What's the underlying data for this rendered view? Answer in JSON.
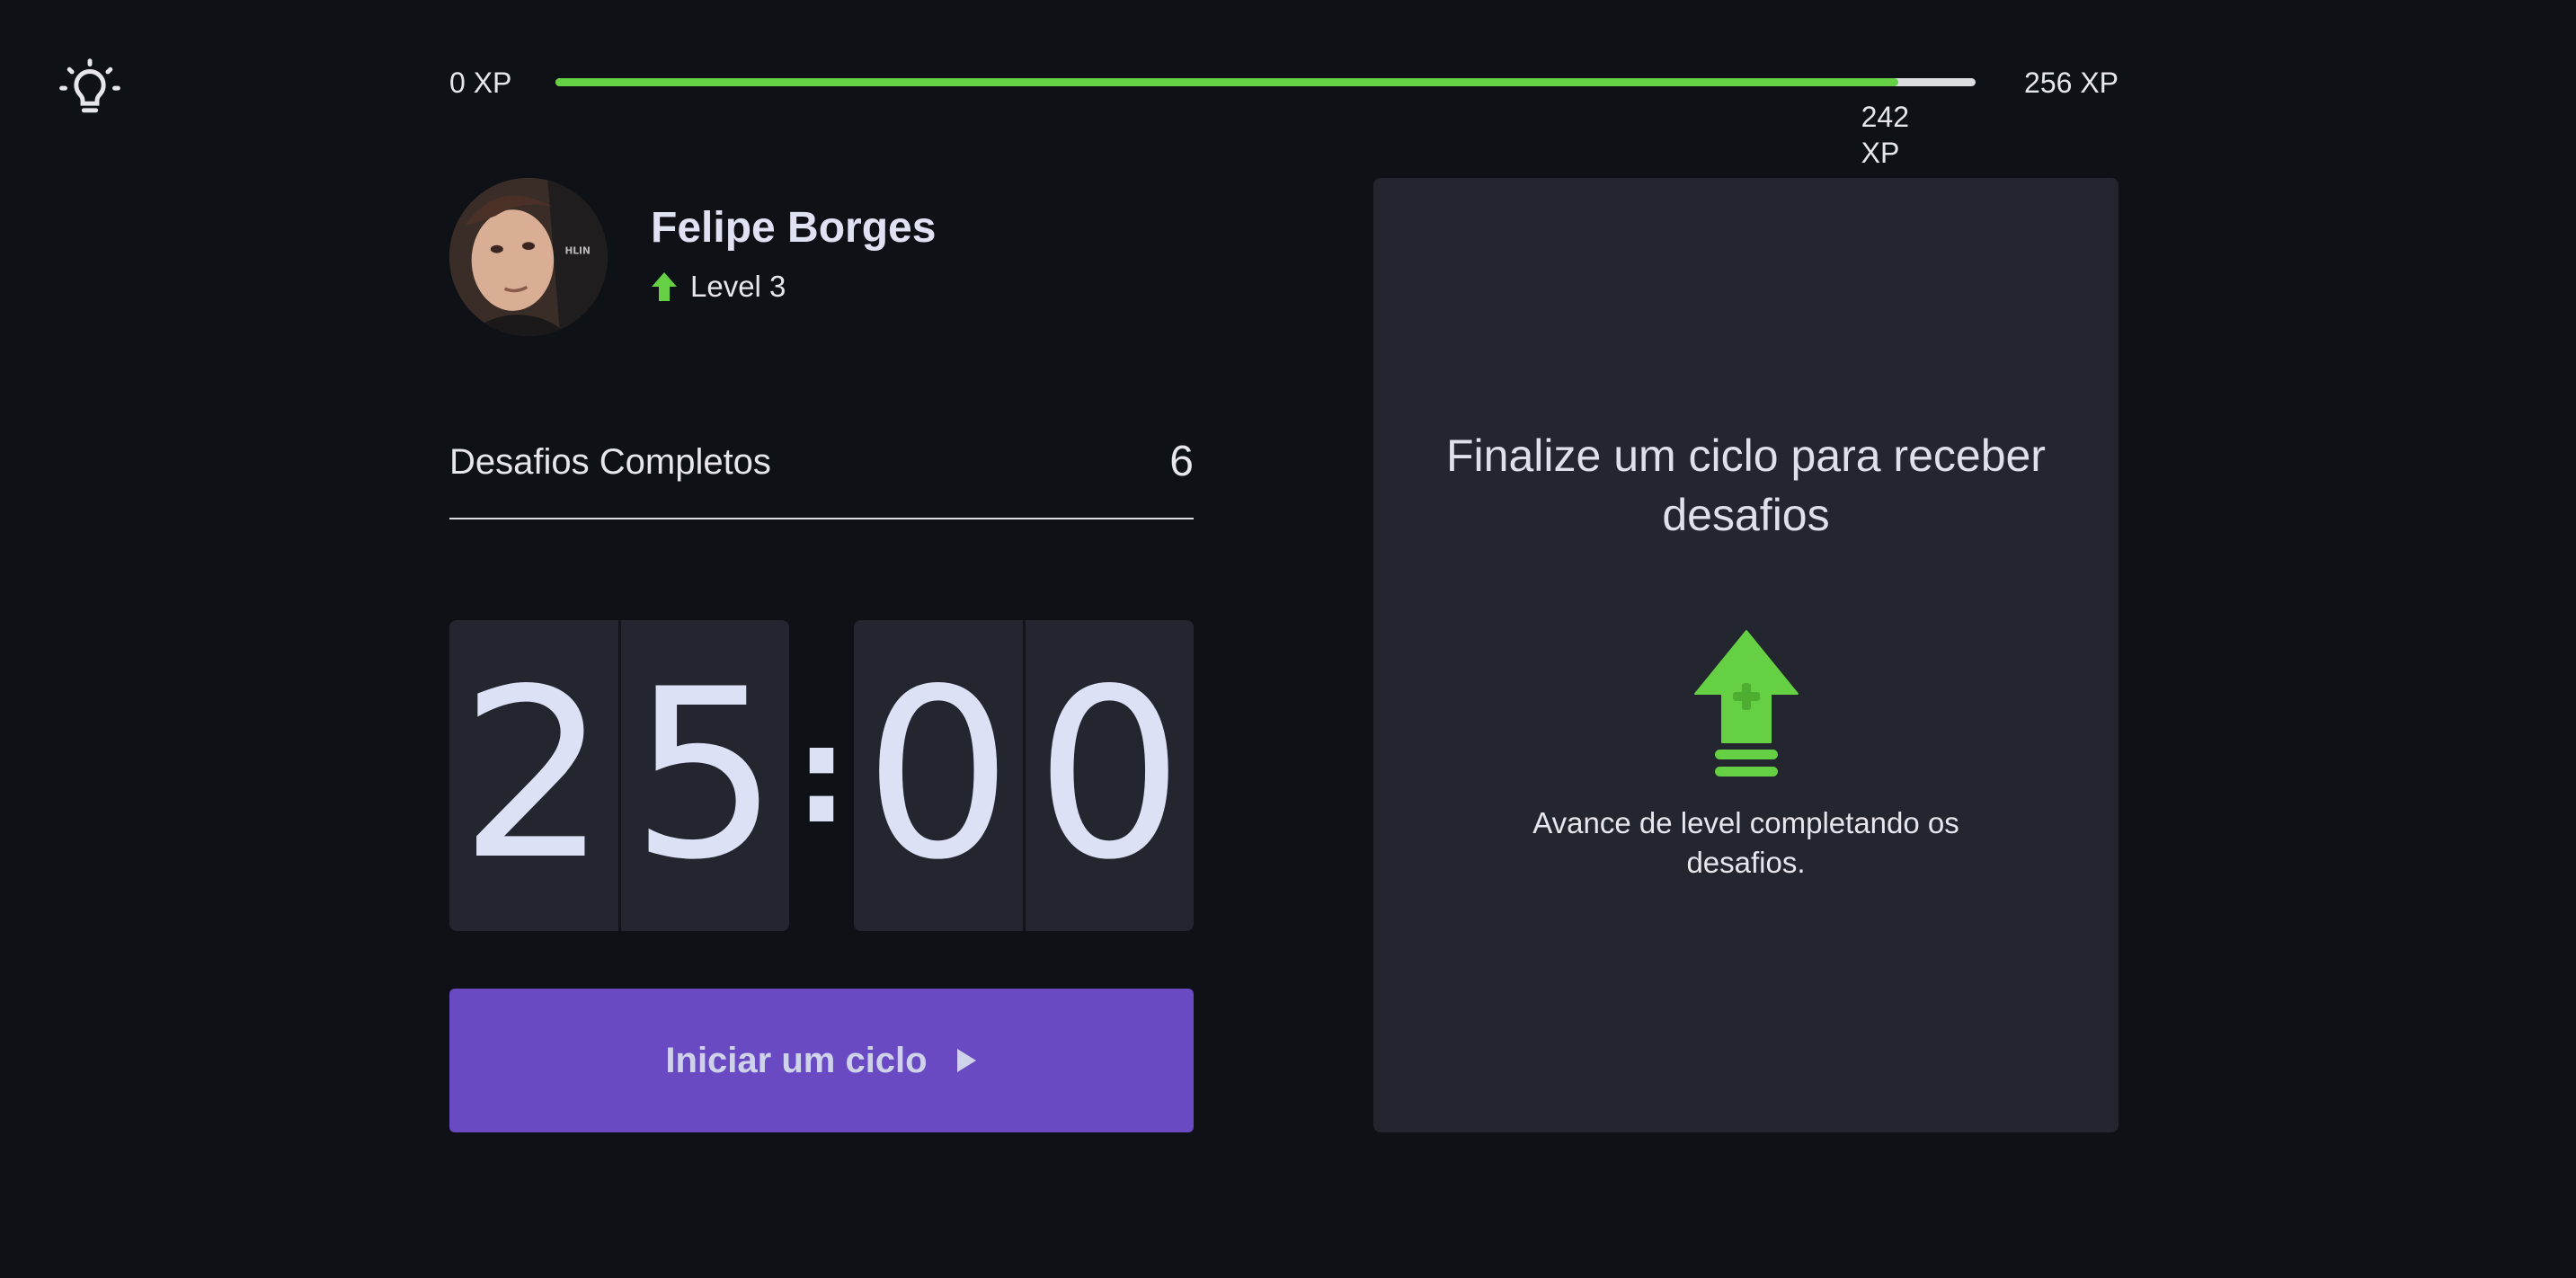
{
  "theme_toggle": {
    "icon": "lightbulb-icon"
  },
  "xp": {
    "min_label": "0 XP",
    "max_label": "256 XP",
    "current_label": "242 XP",
    "current": 242,
    "max": 256
  },
  "profile": {
    "name": "Felipe Borges",
    "level_label": "Level 3",
    "level_icon": "level-up-arrow-icon"
  },
  "challenges": {
    "label": "Desafios Completos",
    "count": "6"
  },
  "countdown": {
    "minute_left": "2",
    "minute_right": "5",
    "separator": ":",
    "second_left": "0",
    "second_right": "0"
  },
  "start_button": {
    "label": "Iniciar um ciclo",
    "icon": "play-icon"
  },
  "challenge_panel": {
    "title": "Finalize um ciclo para receber desafios",
    "icon": "level-up-icon",
    "description": "Avance de level completando os desafios."
  },
  "colors": {
    "background": "#0e1116",
    "panel": "#23262e",
    "green": "#66d045",
    "purple": "#6a4ac3",
    "digit": "#dde1f6"
  }
}
